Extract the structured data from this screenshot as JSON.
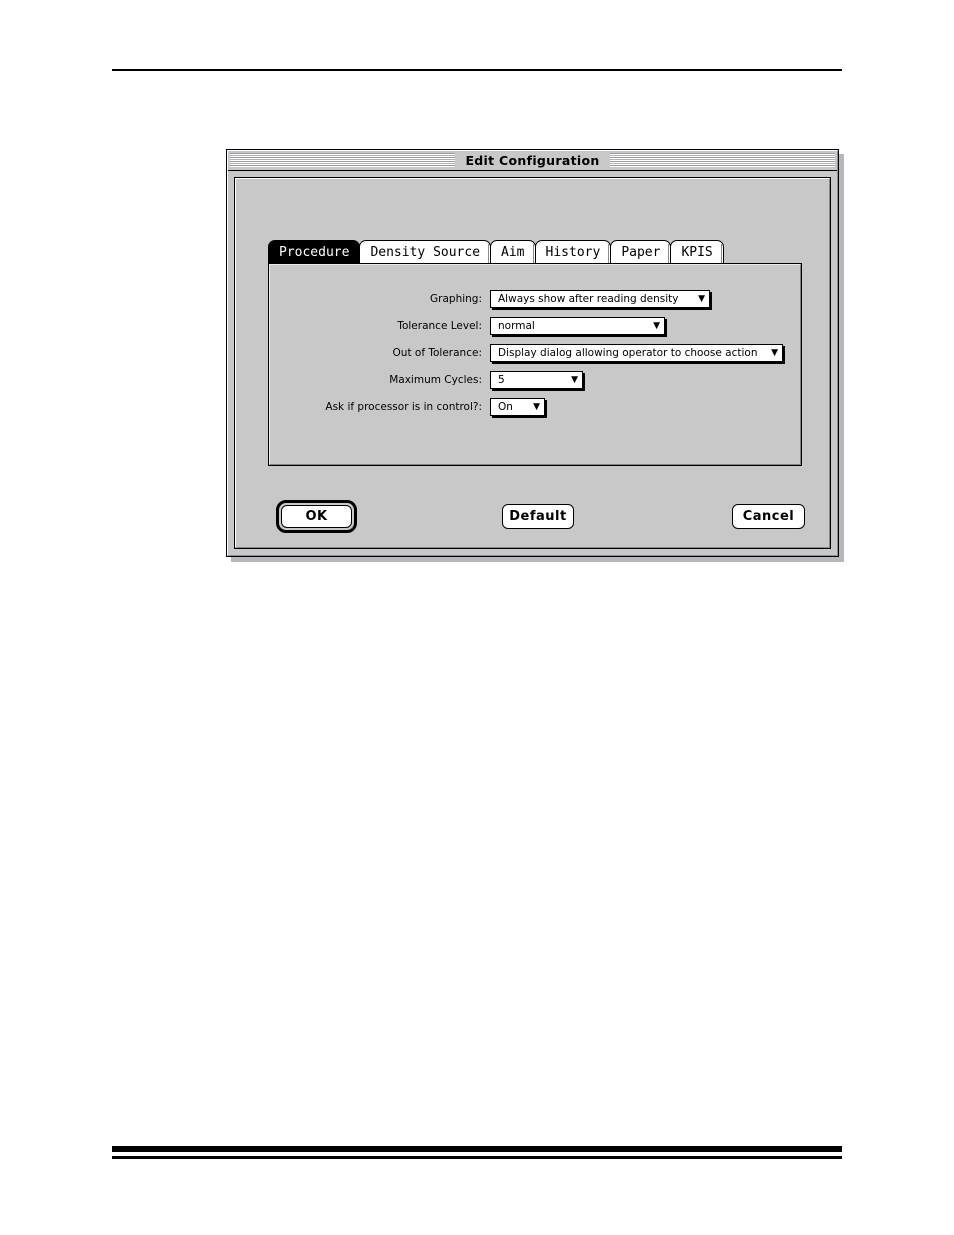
{
  "window": {
    "title": "Edit Configuration"
  },
  "tabs": [
    {
      "label": "Procedure",
      "active": true,
      "name": "tab-procedure"
    },
    {
      "label": "Density Source",
      "active": false,
      "name": "tab-density-source"
    },
    {
      "label": "Aim",
      "active": false,
      "name": "tab-aim"
    },
    {
      "label": "History",
      "active": false,
      "name": "tab-history"
    },
    {
      "label": "Paper",
      "active": false,
      "name": "tab-paper"
    },
    {
      "label": "KPIS",
      "active": false,
      "name": "tab-kpis"
    }
  ],
  "form": {
    "rows": [
      {
        "label": "Graphing:",
        "value": "Always show after reading density",
        "arrow": "▼"
      },
      {
        "label": "Tolerance Level:",
        "value": "normal",
        "arrow": "▼"
      },
      {
        "label": "Out of Tolerance:",
        "value": "Display dialog allowing operator to choose action",
        "arrow": "▼"
      },
      {
        "label": "Maximum Cycles:",
        "value": "5",
        "arrow": "▼"
      },
      {
        "label": "Ask if processor is in control?:",
        "value": "On",
        "arrow": "▼"
      }
    ]
  },
  "buttons": {
    "ok": "OK",
    "default": "Default",
    "cancel": "Cancel"
  },
  "colors": {
    "window_face": "#c8c8c8",
    "active_tab_bg": "#000000",
    "active_tab_fg": "#ffffff",
    "field_bg": "#ffffff",
    "outline": "#000000"
  }
}
